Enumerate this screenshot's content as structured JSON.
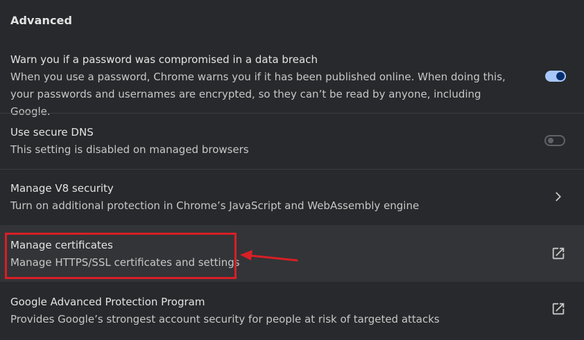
{
  "section": {
    "title": "Advanced"
  },
  "rows": [
    {
      "title": "Warn you if a password was compromised in a data breach",
      "description": "When you use a password, Chrome warns you if it has been published online. When doing this, your passwords and usernames are encrypted, so they can’t be read by anyone, including Google.",
      "control": "toggle",
      "enabled": true
    },
    {
      "title": "Use secure DNS",
      "description": "This setting is disabled on managed browsers",
      "control": "toggle",
      "enabled": false
    },
    {
      "title": "Manage V8 security",
      "description": "Turn on additional protection in Chrome’s JavaScript and WebAssembly engine",
      "control": "chevron-right-icon"
    },
    {
      "title": "Manage certificates",
      "description": "Manage HTTPS/SSL certificates and settings",
      "control": "open-in-new-icon"
    },
    {
      "title": "Google Advanced Protection Program",
      "description": "Provides Google’s strongest account security for people at risk of targeted attacks",
      "control": "open-in-new-icon"
    }
  ],
  "colors": {
    "background": "#28292c",
    "hover_row": "#333437",
    "toggle_on": "#a8c7fa",
    "annotation_red": "#d81f26"
  }
}
